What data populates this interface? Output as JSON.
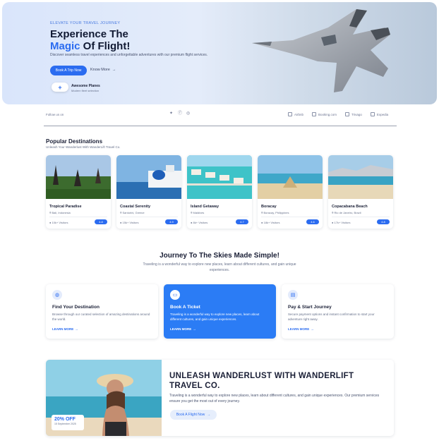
{
  "hero": {
    "eyebrow": "ELEVATE YOUR TRAVEL JOURNEY",
    "title_line1": "Experience The",
    "title_highlight": "Magic",
    "title_line2_rest": " Of Flight!",
    "subtitle": "Discover seamless travel experiences and unforgettable adventures with our premium flight services.",
    "primary_button": "Book A Trip Now",
    "secondary_link": "Know More",
    "planes_title": "Awesome Planes",
    "planes_sub": "Modern fleet selection"
  },
  "social": {
    "follow": "Follow us on",
    "partners": [
      "Airbnb",
      "Booking.com",
      "Trivago",
      "Expedia"
    ]
  },
  "popular": {
    "title": "Popular Destinations",
    "subtitle": "Unleash Your Wanderlust With WanderLift Travel Co.",
    "cards": [
      {
        "name": "Tropical Paradise",
        "location": "Bali, Indonesia",
        "visitors": "10k+ Visitors",
        "rating": "4.8"
      },
      {
        "name": "Coastal Serenity",
        "location": "Santorini, Greece",
        "visitors": "15k+ Visitors",
        "rating": "4.9"
      },
      {
        "name": "Island Getaway",
        "location": "Maldives",
        "visitors": "8k+ Visitors",
        "rating": "4.7"
      },
      {
        "name": "Boracay",
        "location": "Boracay, Philippines",
        "visitors": "18k+ Visitors",
        "rating": "4.6"
      },
      {
        "name": "Copacabana Beach",
        "location": "Rio de Janeiro, Brazil",
        "visitors": "17k+ Visitors",
        "rating": "4.8"
      }
    ]
  },
  "journey": {
    "title": "Journey To The Skies Made Simple!",
    "subtitle": "Traveling is a wonderful way to explore new places, learn about different cultures, and gain unique experiences.",
    "steps": [
      {
        "title": "Find Your Destination",
        "text": "Browse through our curated selection of amazing destinations around the world.",
        "link": "LEARN MORE"
      },
      {
        "title": "Book A Ticket",
        "text": "Traveling is a wonderful way to explore new places, learn about different cultures, and gain unique experiences.",
        "link": "LEARN MORE"
      },
      {
        "title": "Pay & Start Journey",
        "text": "Secure payment options and instant confirmation to start your adventure right away.",
        "link": "LEARN MORE"
      }
    ]
  },
  "cta": {
    "title": "UNLEASH WANDERLUST WITH WANDERLIFT TRAVEL CO.",
    "text": "Traveling is a wonderful way to explore new places, learn about different cultures, and gain unique experiences. Our premium services ensure you get the most out of every journey.",
    "button": "Book A Flight Now",
    "promo_value": "20% OFF",
    "promo_date": "15 September 2025"
  },
  "colors": {
    "accent": "#2b6cf0",
    "active_step": "#2b7cf5"
  }
}
